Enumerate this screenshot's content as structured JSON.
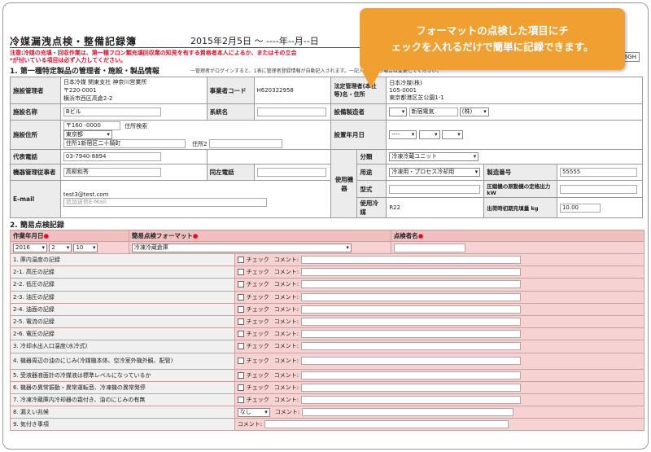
{
  "callout": {
    "line1": "フォーマットの点検した項目にチ",
    "line2": "ェックを入れるだけで簡単に記録できます。"
  },
  "header": {
    "title": "冷媒漏洩点検・整備記録簿",
    "date_range": "2015年2月5日 〜 ----年--月--日",
    "notice_line1": "注意:冷媒の充填・回収作業は、第一種フロン類充填回収業の知見を有する資格者本人によるか、またはその立会",
    "notice_line2": "*が付いている項目は必ず入力してください。",
    "tr_code": "--M6GH"
  },
  "section1": {
    "title": "1. 第一種特定製品の管理者・施設・製品情報",
    "note": "一管理者がログインすると、1表に管理者登録情報が自動記入されます。一記入者が違う場合は変更してください。",
    "admin_label": "施設管理者",
    "admin_name": "日本冷媒 関東支社 神奈川営業所",
    "admin_zip": "〒220-0001",
    "admin_addr": "横浜市西区高倉2-2",
    "bizcode_label": "事業者コード",
    "bizcode_value": "H620322958",
    "corp_label": "法定管理者(本社等)名・住所",
    "corp_name": "日本冷媒(株)",
    "corp_zip": "105-0001",
    "corp_addr": "東京都港区芝公園1-1",
    "facility_label": "施設名称",
    "facility_value": "Bビル",
    "system_label": "系統名",
    "maker_label": "設備製造者",
    "maker_value": "新宿電気",
    "maker_suffix": "(株)",
    "addr_label": "施設住所",
    "zip_value": "〒160 -0000",
    "zip_search": "住所検索",
    "pref_value": "東京都",
    "addr1_value": "住所1新宿区二十騎町",
    "addr2_label": "住所2",
    "install_label": "設置年月日",
    "install_value": "----",
    "category_label": "分類",
    "category_value": "冷凍冷蔵ユニット",
    "tel_label": "代表電話",
    "tel_value": "03-7940-8894",
    "usage_group": "使用機器",
    "purpose_label": "用途",
    "purpose_value": "冷凍用・プロセス冷却用",
    "serial_label": "製造番号",
    "serial_value": "55555",
    "mgr_label": "機器管理従事者",
    "mgr_value": "高柳和秀",
    "samephone_label": "同左電話",
    "model_label": "型式",
    "compressor_label": "圧縮機の原動機の定格出力 kW",
    "email_label": "E-mail",
    "email_value": "test3@test.com",
    "email_placeholder": "追加送信E-Mail:",
    "refrig_label": "使用冷媒",
    "refrig_value": "R22",
    "charge_label": "出荷時初期充填量 kg",
    "charge_value": "10.00"
  },
  "section2": {
    "title": "2. 簡易点検記録",
    "date_header": "作業年月日",
    "format_header": "簡易点検フォーマット",
    "inspector_header": "点検者名",
    "req_mark": "●",
    "year": "2016",
    "month": "2",
    "day": "10",
    "format_value": "冷凍冷蔵倉庫",
    "check_label": "チェック",
    "comment_label": "コメント:",
    "smell_select": "なし",
    "items": [
      {
        "label": "1. 庫内温度の記録",
        "type": "check"
      },
      {
        "label": "2-1. 高圧の記録",
        "type": "check"
      },
      {
        "label": "2-2. 低圧の記録",
        "type": "check"
      },
      {
        "label": "2-3. 油圧の記録",
        "type": "check"
      },
      {
        "label": "2-4. 油面の記録",
        "type": "check"
      },
      {
        "label": "2-5. 電流の記録",
        "type": "check"
      },
      {
        "label": "2-6. 電圧の記録",
        "type": "check"
      },
      {
        "label": "3. 冷却水出入口温度(水冷式)",
        "type": "check"
      },
      {
        "label": "4. 機器周辺の油のにじみ(冷媒機本体、空冷室外機外観、配管)",
        "type": "check"
      },
      {
        "label": "5. 受液器液面計の冷媒液は標準レベルになっているか",
        "type": "check"
      },
      {
        "label": "6. 機器の異常振動・異常運転音、冷凍機の異常発停",
        "type": "check"
      },
      {
        "label": "7. 冷凍冷蔵庫内冷却器の霜付き、油のにじみの有無",
        "type": "check"
      },
      {
        "label": "8. 漏えい兆候",
        "type": "select"
      },
      {
        "label": "9. 気付き事項",
        "type": "comment"
      }
    ]
  }
}
